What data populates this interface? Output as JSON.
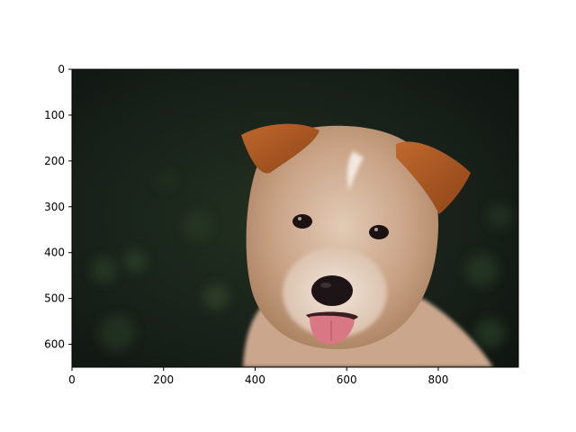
{
  "image": {
    "subject": "puppy-photo",
    "extent": {
      "x": [
        0,
        975
      ],
      "y": [
        0,
        650
      ]
    }
  },
  "axes": {
    "x_ticks": [
      {
        "value": 0,
        "label": "0"
      },
      {
        "value": 200,
        "label": "200"
      },
      {
        "value": 400,
        "label": "400"
      },
      {
        "value": 600,
        "label": "600"
      },
      {
        "value": 800,
        "label": "800"
      }
    ],
    "y_ticks": [
      {
        "value": 0,
        "label": "0"
      },
      {
        "value": 100,
        "label": "100"
      },
      {
        "value": 200,
        "label": "200"
      },
      {
        "value": 300,
        "label": "300"
      },
      {
        "value": 400,
        "label": "400"
      },
      {
        "value": 500,
        "label": "500"
      },
      {
        "value": 600,
        "label": "600"
      }
    ],
    "y_direction": "down",
    "grid": false
  },
  "colors": {
    "background": "#17201a",
    "fur": "#c9a285",
    "fur_light": "#e6d3c2",
    "ears": "#b45a23",
    "nose": "#1c1416",
    "tongue": "#d97784"
  }
}
